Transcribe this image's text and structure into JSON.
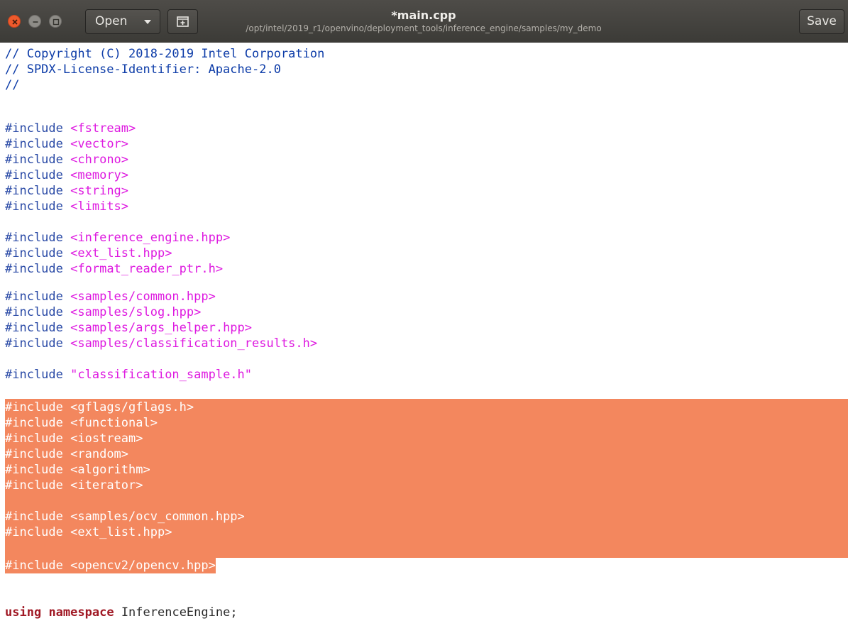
{
  "window": {
    "title": "*main.cpp",
    "subtitle": "/opt/intel/2019_r1/openvino/deployment_tools/inference_engine/samples/my_demo"
  },
  "toolbar": {
    "open_label": "Open",
    "save_label": "Save",
    "icons": [
      "close-icon",
      "minimize-icon",
      "maximize-icon",
      "chevron-down-icon",
      "new-tab-icon"
    ]
  },
  "colors": {
    "comment": "#0d3ca8",
    "preprocessor": "#2a4aa6",
    "include_path": "#de1ae0",
    "keyword": "#a01824",
    "selection": "#f3875e"
  },
  "code": {
    "line_01": "// Copyright (C) 2018-2019 Intel Corporation",
    "line_02": "// SPDX-License-Identifier: Apache-2.0",
    "line_03": "//",
    "include_kw": "#include",
    "inc_fstream": "<fstream>",
    "inc_vector": "<vector>",
    "inc_chrono": "<chrono>",
    "inc_memory": "<memory>",
    "inc_string": "<string>",
    "inc_limits": "<limits>",
    "inc_inference_engine": "<inference_engine.hpp>",
    "inc_ext_list": "<ext_list.hpp>",
    "inc_format_reader": "<format_reader_ptr.h>",
    "inc_samples_common": "<samples/common.hpp>",
    "inc_samples_slog": "<samples/slog.hpp>",
    "inc_samples_args_helper": "<samples/args_helper.hpp>",
    "inc_samples_classification_results": "<samples/classification_results.h>",
    "inc_classification_sample": "\"classification_sample.h\"",
    "inc_gflags": "<gflags/gflags.h>",
    "inc_functional": "<functional>",
    "inc_iostream": "<iostream>",
    "inc_random": "<random>",
    "inc_algorithm": "<algorithm>",
    "inc_iterator": "<iterator>",
    "inc_samples_ocv_common": "<samples/ocv_common.hpp>",
    "inc_ext_list_2": "<ext_list.hpp>",
    "inc_opencv": "<opencv2/opencv.hpp>",
    "kw_using": "using",
    "kw_namespace": "namespace",
    "ns_name": "InferenceEngine;"
  }
}
